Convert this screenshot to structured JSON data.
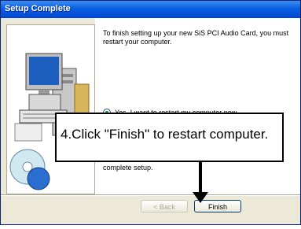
{
  "window": {
    "title": "Setup Complete"
  },
  "content": {
    "message": "To finish setting up your new SiS PCI Audio Card, you must restart your computer.",
    "radio_label": "Yes, I want to restart my computer now.",
    "bottom_text": "complete setup."
  },
  "buttons": {
    "back": "< Back",
    "finish": "Finish"
  },
  "callout": {
    "text": "4.Click \"Finish\" to restart computer."
  }
}
